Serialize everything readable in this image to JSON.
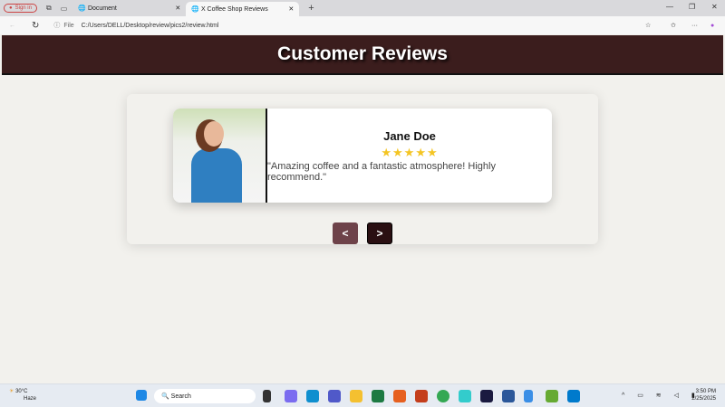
{
  "browser": {
    "sign_in": "Sign in",
    "tabs": [
      {
        "label": "Document"
      },
      {
        "label": "X Coffee Shop Reviews"
      }
    ],
    "file_label": "File",
    "url": "C:/Users/DELL/Desktop/review/pics2/review.html"
  },
  "page": {
    "title": "Customer Reviews",
    "review": {
      "name": "Jane Doe",
      "rating": 5,
      "stars": "★★★★★",
      "text": "\"Amazing coffee and a fantastic atmosphere! Highly recommend.\""
    },
    "prev_label": "<",
    "next_label": ">"
  },
  "taskbar": {
    "temp": "30°C",
    "weather": "Haze",
    "search": "Search",
    "time": "3:50 PM",
    "date": "2/25/2025"
  },
  "colors": {
    "header": "#3b1d1d",
    "prev": "#6d4249",
    "next": "#2a0f12",
    "star": "#f4c524"
  }
}
